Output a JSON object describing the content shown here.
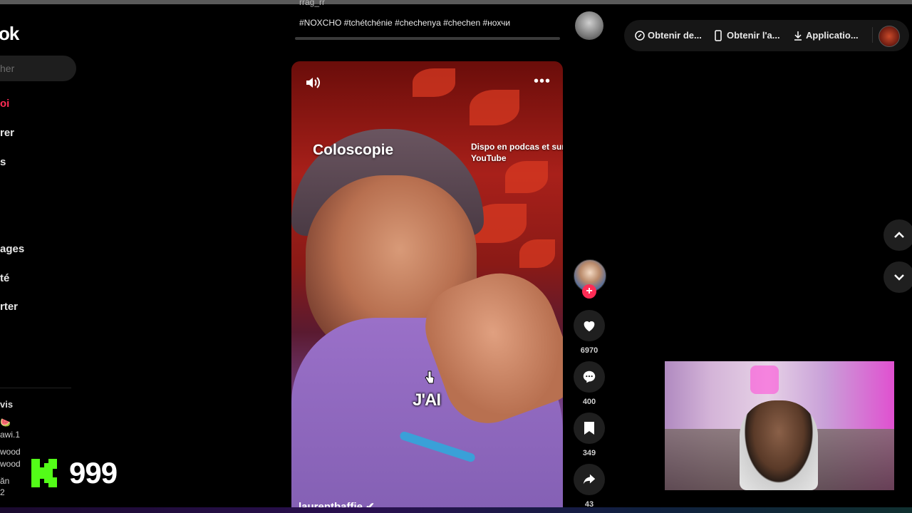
{
  "sidebar": {
    "logo": "ok",
    "search_placeholder": "her",
    "nav": [
      {
        "label": "oi",
        "active": true
      },
      {
        "label": "rer"
      },
      {
        "label": "s"
      },
      {
        "label": "ages"
      },
      {
        "label": "té"
      },
      {
        "label": "rter"
      }
    ],
    "following_title": "vis",
    "following": [
      {
        "line1": "🍉",
        "line2": "awi.1"
      },
      {
        "line1": "wood",
        "line2": "wood"
      },
      {
        "line1": "ăn",
        "line2": "2"
      }
    ]
  },
  "overlay": {
    "k_badge": "K",
    "k_count": "999"
  },
  "prev_video": {
    "cut_text": "rrag_rr",
    "hashtags": "#NOXCHO #tchétchénie #chechenya #chechen #нохчи"
  },
  "video": {
    "title": "Coloscopie",
    "promo": "Dispo en podcas et sur YouTube",
    "caption": "J'AI",
    "author": "laurentbaffie ✔"
  },
  "actions": {
    "likes": "6970",
    "comments": "400",
    "saves": "349",
    "shares": "43"
  },
  "toolbar": {
    "item1": "Obtenir de...",
    "item2": "Obtenir l'a...",
    "item3": "Applicatio..."
  },
  "colors": {
    "accent": "#fe2c55",
    "background": "#000000",
    "kick_green": "#53fc18"
  },
  "icons": [
    "sound-icon",
    "more-icon",
    "heart-icon",
    "comment-icon",
    "bookmark-icon",
    "share-icon",
    "coin-icon",
    "phone-icon",
    "download-icon",
    "chevron-up-icon",
    "chevron-down-icon"
  ]
}
